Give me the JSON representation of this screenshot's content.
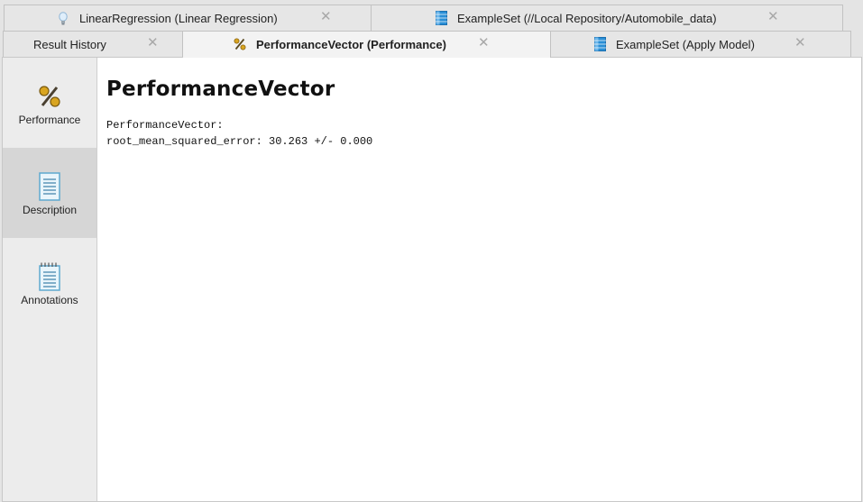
{
  "tabs_top": [
    {
      "label": "LinearRegression (Linear Regression)",
      "icon": "lightbulb-icon"
    },
    {
      "label": "ExampleSet (//Local Repository/Automobile_data)",
      "icon": "table-icon"
    }
  ],
  "tabs_bottom": [
    {
      "label": "Result History",
      "icon": ""
    },
    {
      "label": "PerformanceVector (Performance)",
      "icon": "percent-icon",
      "active": true
    },
    {
      "label": "ExampleSet (Apply Model)",
      "icon": "table-icon"
    }
  ],
  "close_glyph": "✕",
  "sidebar": {
    "items": [
      {
        "label": "Performance",
        "icon": "percent-icon"
      },
      {
        "label": "Description",
        "icon": "document-icon",
        "selected": true
      },
      {
        "label": "Annotations",
        "icon": "notepad-icon"
      }
    ]
  },
  "content": {
    "title": "PerformanceVector",
    "lines": [
      "PerformanceVector:",
      "root_mean_squared_error: 30.263 +/- 0.000"
    ]
  },
  "colors": {
    "tab_active_bg": "#f3f3f3",
    "tab_bg": "#e6e6e6",
    "sidebar_selected_bg": "#d6d6d6",
    "table_icon_blue": "#2a8fd6",
    "percent_icon_gold": "#d9a520"
  }
}
